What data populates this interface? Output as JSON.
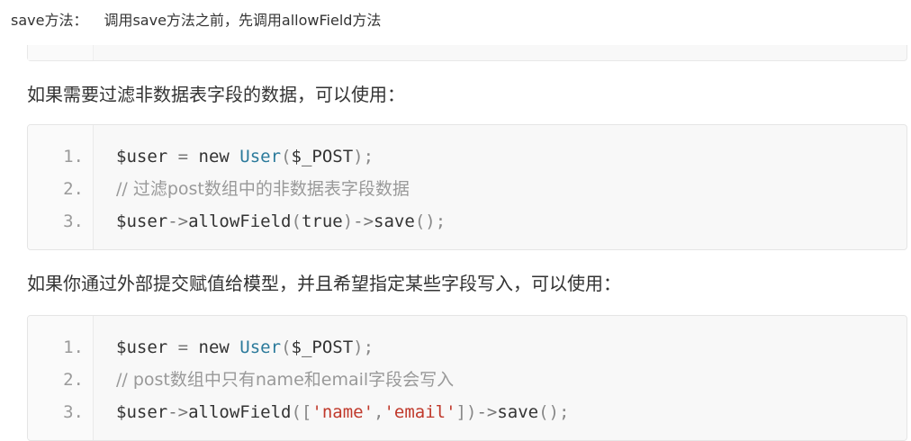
{
  "header": {
    "label": "save方法：",
    "text": "调用save方法之前，先调用allowField方法"
  },
  "paragraphs": [
    "如果需要过滤非数据表字段的数据，可以使用：",
    "如果你通过外部提交赋值给模型，并且希望指定某些字段写入，可以使用："
  ],
  "code_blocks": [
    {
      "lines": [
        {
          "number": "1.",
          "tokens": [
            {
              "type": "var",
              "text": "$user"
            },
            {
              "type": "op",
              "text": " = "
            },
            {
              "type": "kw",
              "text": "new "
            },
            {
              "type": "cls",
              "text": "User"
            },
            {
              "type": "punc",
              "text": "("
            },
            {
              "type": "var",
              "text": "$_POST"
            },
            {
              "type": "punc",
              "text": ");"
            }
          ]
        },
        {
          "number": "2.",
          "tokens": [
            {
              "type": "comment",
              "text": "// 过滤post数组中的非数据表字段数据"
            }
          ]
        },
        {
          "number": "3.",
          "tokens": [
            {
              "type": "var",
              "text": "$user"
            },
            {
              "type": "op",
              "text": "->"
            },
            {
              "type": "plain",
              "text": "allowField"
            },
            {
              "type": "punc",
              "text": "("
            },
            {
              "type": "kw",
              "text": "true"
            },
            {
              "type": "punc",
              "text": ")"
            },
            {
              "type": "op",
              "text": "->"
            },
            {
              "type": "plain",
              "text": "save"
            },
            {
              "type": "punc",
              "text": "();"
            }
          ]
        }
      ]
    },
    {
      "lines": [
        {
          "number": "1.",
          "tokens": [
            {
              "type": "var",
              "text": "$user"
            },
            {
              "type": "op",
              "text": " = "
            },
            {
              "type": "kw",
              "text": "new "
            },
            {
              "type": "cls",
              "text": "User"
            },
            {
              "type": "punc",
              "text": "("
            },
            {
              "type": "var",
              "text": "$_POST"
            },
            {
              "type": "punc",
              "text": ");"
            }
          ]
        },
        {
          "number": "2.",
          "tokens": [
            {
              "type": "comment",
              "text": "// post数组中只有name和email字段会写入"
            }
          ]
        },
        {
          "number": "3.",
          "tokens": [
            {
              "type": "var",
              "text": "$user"
            },
            {
              "type": "op",
              "text": "->"
            },
            {
              "type": "plain",
              "text": "allowField"
            },
            {
              "type": "punc",
              "text": "(["
            },
            {
              "type": "str",
              "text": "'name'"
            },
            {
              "type": "punc",
              "text": ","
            },
            {
              "type": "str",
              "text": "'email'"
            },
            {
              "type": "punc",
              "text": "])"
            },
            {
              "type": "op",
              "text": "->"
            },
            {
              "type": "plain",
              "text": "save"
            },
            {
              "type": "punc",
              "text": "();"
            }
          ]
        }
      ]
    }
  ],
  "colors": {
    "text": "#333333",
    "class_name": "#2b7a9b",
    "string": "#c0392b",
    "comment": "#999999",
    "line_number": "#9a9a9a",
    "code_background": "#f8f8f8"
  }
}
